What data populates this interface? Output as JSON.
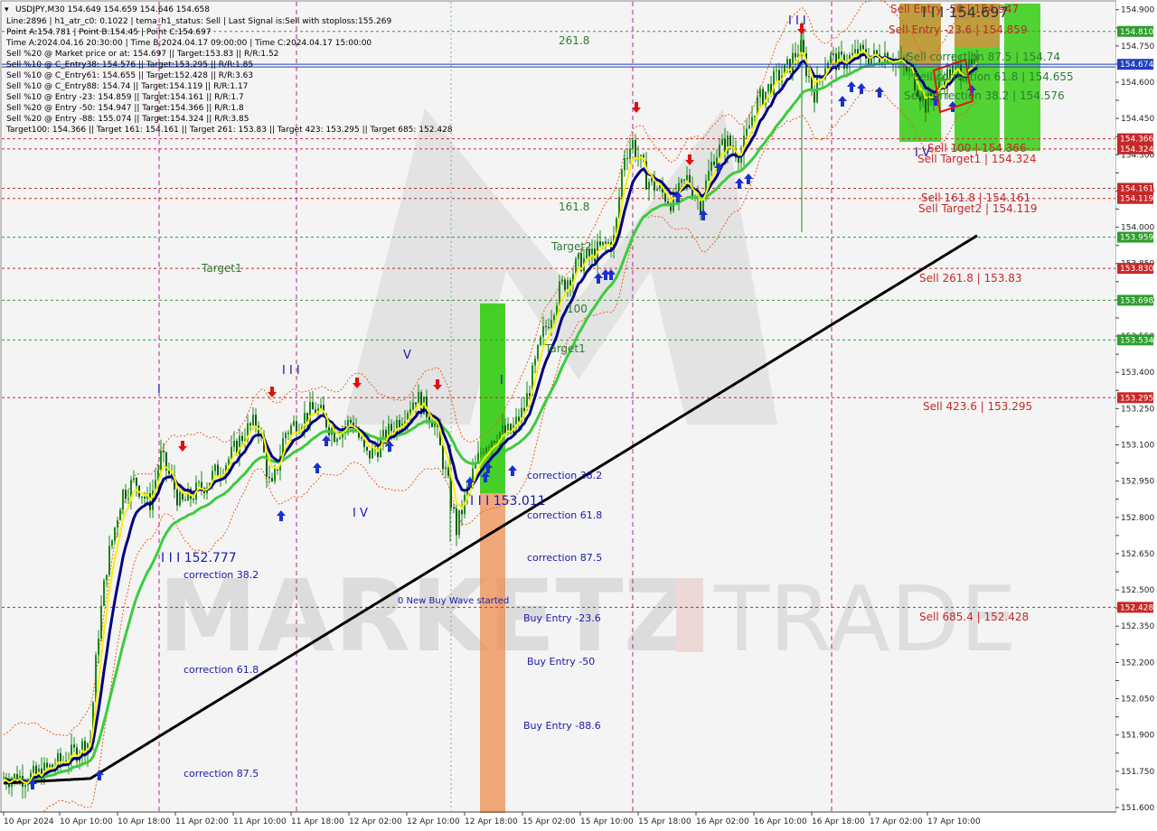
{
  "window": {
    "title": "USDJPY,M30"
  },
  "info_lines": [
    "USDJPY,M30   154.649 154.659 154.646 154.658",
    "Line:2896 | h1_atr_c0: 0.1022 | tema_h1_status: Sell | Last Signal is:Sell with stoploss:155.269",
    "Point A:154.781 | Point B:154.45 | Point C:154.697",
    "Time A:2024.04.16 20:30:00 | Time B:2024.04.17 09:00:00 | Time C:2024.04.17 15:00:00",
    "Sell %20 @ Market price or at: 154.697 || Target:153.83 || R/R:1.52",
    "Sell %10 @ C_Entry38: 154.576 || Target:153.295 || R/R:1.85",
    "Sell %10 @ C_Entry61: 154.655 || Target:152.428 || R/R:3.63",
    "Sell %10 @ C_Entry88: 154.74 || Target:154.119 || R/R:1.17",
    "Sell %10 @ Entry -23: 154.859 || Target:154.161 || R/R:1.7",
    "Sell %20 @ Entry -50: 154.947 || Target:154.366 || R/R:1.8",
    "Sell %20 @ Entry -88: 155.074 || Target:154.324 || R/R:3.85",
    "Target100: 154.366 || Target 161: 154.161 || Target 261: 153.83 || Target 423: 153.295 || Target 685: 152.428"
  ],
  "watermark": {
    "left": "MARKETZ",
    "right": "TRADE"
  },
  "colors": {
    "candle": "#1a8a1a",
    "ema_fast": "#ffee00",
    "ema_mid": "#000080",
    "ema_slow": "#3ccc3c",
    "ema_long": "#000000",
    "level_red": "#c62828",
    "level_green": "#2e7d32",
    "zone_green": "#33cc11",
    "zone_orange": "#ee8844",
    "current_price_bg": "#1f3fbf"
  },
  "chart_data": {
    "type": "candlestick",
    "symbol": "USDJPY",
    "timeframe": "M30",
    "ylim": [
      151.6,
      154.925
    ],
    "y_ticks": [
      151.6,
      151.675,
      151.75,
      151.825,
      151.9,
      151.975,
      152.05,
      152.125,
      152.2,
      152.275,
      152.35,
      152.425,
      152.5,
      152.575,
      152.65,
      152.725,
      152.8,
      152.875,
      152.95,
      153.025,
      153.1,
      153.175,
      153.25,
      153.325,
      153.4,
      153.475,
      153.55,
      153.625,
      153.7,
      153.775,
      153.85,
      153.925,
      154.0,
      154.075,
      154.15,
      154.225,
      154.3,
      154.375,
      154.45,
      154.525,
      154.6,
      154.675,
      154.75,
      154.825,
      154.9
    ],
    "y_tick_labels": [
      "151.600",
      "",
      "151.750",
      "",
      "151.900",
      "",
      "152.050",
      "",
      "152.200",
      "",
      "152.350",
      "",
      "152.500",
      "",
      "152.650",
      "",
      "152.800",
      "",
      "152.950",
      "",
      "153.100",
      "",
      "153.250",
      "",
      "153.400",
      "",
      "153.550",
      "",
      "153.700",
      "",
      "153.850",
      "",
      "154.000",
      "",
      "154.150",
      "",
      "154.300",
      "",
      "154.450",
      "",
      "154.600",
      "",
      "154.750",
      "",
      "154.900"
    ],
    "x_tick_labels": [
      "10 Apr 2024",
      "10 Apr 10:00",
      "10 Apr 18:00",
      "11 Apr 02:00",
      "11 Apr 10:00",
      "11 Apr 18:00",
      "12 Apr 02:00",
      "12 Apr 10:00",
      "12 Apr 18:00",
      "15 Apr 02:00",
      "15 Apr 10:00",
      "15 Apr 18:00",
      "16 Apr 02:00",
      "16 Apr 10:00",
      "16 Apr 18:00",
      "17 Apr 02:00",
      "17 Apr 10:00"
    ],
    "current_price": 154.674,
    "right_axis_tags": [
      {
        "value": 154.81,
        "label": "154.810",
        "color": "#2e9e2e"
      },
      {
        "value": 154.674,
        "label": "154.674",
        "color": "#1f3fbf"
      },
      {
        "value": 154.366,
        "label": "154.366",
        "color": "#c62828"
      },
      {
        "value": 154.324,
        "label": "154.324",
        "color": "#c62828"
      },
      {
        "value": 154.161,
        "label": "154.161",
        "color": "#c62828"
      },
      {
        "value": 154.119,
        "label": "154.119",
        "color": "#c62828"
      },
      {
        "value": 153.959,
        "label": "153.959",
        "color": "#2e9e2e"
      },
      {
        "value": 153.83,
        "label": "153.830",
        "color": "#c62828"
      },
      {
        "value": 153.698,
        "label": "153.698",
        "color": "#2e9e2e"
      },
      {
        "value": 153.534,
        "label": "153.534",
        "color": "#2e9e2e"
      },
      {
        "value": 153.295,
        "label": "153.295",
        "color": "#c62828"
      },
      {
        "value": 152.428,
        "label": "152.428",
        "color": "#c62828"
      }
    ],
    "level_labels": [
      {
        "text": "Sell Entry -50 | 154.947",
        "value": 154.947,
        "color": "red"
      },
      {
        "text": "I I I 154.697",
        "value": 154.9,
        "color": "dark"
      },
      {
        "text": "Sell Entry -23.6 | 154.859",
        "value": 154.859,
        "color": "red"
      },
      {
        "text": "Sell correction 87.5 | 154.74",
        "value": 154.74,
        "color": "green"
      },
      {
        "text": "Sell correction 61.8 | 154.655",
        "value": 154.655,
        "color": "green"
      },
      {
        "text": "Sell correction 38.2 | 154.576",
        "value": 154.576,
        "color": "green"
      },
      {
        "text": "Sell 100 | 154.366",
        "value": 154.366,
        "color": "red"
      },
      {
        "text": "Sell Target1 | 154.324",
        "value": 154.324,
        "color": "red"
      },
      {
        "text": "Sell 161.8 | 154.161",
        "value": 154.161,
        "color": "red"
      },
      {
        "text": "Sell Target2 | 154.119",
        "value": 154.119,
        "color": "red"
      },
      {
        "text": "Sell  261.8 | 153.83",
        "value": 153.83,
        "color": "red"
      },
      {
        "text": "Sell  423.6 | 153.295",
        "value": 153.295,
        "color": "red"
      },
      {
        "text": "Sell  685.4 | 152.428",
        "value": 152.428,
        "color": "red"
      }
    ],
    "left_labels": [
      {
        "text": "261.8",
        "color": "green"
      },
      {
        "text": "161.8",
        "color": "green"
      },
      {
        "text": "Target2",
        "color": "green"
      },
      {
        "text": "100",
        "color": "green"
      },
      {
        "text": "Target1",
        "color": "green"
      },
      {
        "text": "Target1",
        "color": "green"
      },
      {
        "text": "correction 38.2",
        "color": "blue"
      },
      {
        "text": "correction 61.8",
        "color": "blue"
      },
      {
        "text": "correction 87.5",
        "color": "blue"
      },
      {
        "text": "I I I 153.011",
        "color": "blue"
      },
      {
        "text": "0 New Buy Wave started",
        "color": "blue"
      },
      {
        "text": "Buy Entry -23.6",
        "color": "blue"
      },
      {
        "text": "Buy Entry -50",
        "color": "blue"
      },
      {
        "text": "Buy Entry -88.6",
        "color": "blue"
      },
      {
        "text": "I I I 152.777",
        "color": "blue"
      },
      {
        "text": "correction 38.2",
        "color": "blue"
      },
      {
        "text": "correction 61.8",
        "color": "blue"
      },
      {
        "text": "correction 87.5",
        "color": "blue"
      },
      {
        "text": "I I I",
        "color": "blue"
      },
      {
        "text": "I V",
        "color": "blue"
      },
      {
        "text": "V",
        "color": "blue"
      },
      {
        "text": "I",
        "color": "blue"
      },
      {
        "text": "I",
        "color": "blue"
      },
      {
        "text": "I I I",
        "color": "blue"
      },
      {
        "text": "I V",
        "color": "blue"
      }
    ],
    "green_levels": [
      154.81,
      153.959,
      153.698,
      153.534
    ],
    "red_levels": [
      154.366,
      154.324,
      154.161,
      154.119,
      153.83,
      153.295,
      152.428
    ],
    "series": [
      {
        "name": "price",
        "kind": "candles",
        "anchors": [
          [
            0,
            151.72
          ],
          [
            40,
            151.73
          ],
          [
            80,
            151.82
          ],
          [
            100,
            151.88
          ],
          [
            108,
            152.3
          ],
          [
            118,
            152.6
          ],
          [
            135,
            152.9
          ],
          [
            150,
            152.95
          ],
          [
            165,
            152.85
          ],
          [
            178,
            153.05
          ],
          [
            190,
            152.95
          ],
          [
            200,
            152.85
          ],
          [
            215,
            152.9
          ],
          [
            230,
            152.95
          ],
          [
            255,
            153.05
          ],
          [
            270,
            153.15
          ],
          [
            285,
            153.2
          ],
          [
            300,
            152.9
          ],
          [
            315,
            153.15
          ],
          [
            330,
            153.2
          ],
          [
            350,
            153.25
          ],
          [
            370,
            153.15
          ],
          [
            390,
            153.2
          ],
          [
            405,
            153.05
          ],
          [
            420,
            153.1
          ],
          [
            440,
            153.2
          ],
          [
            460,
            153.3
          ],
          [
            480,
            153.2
          ],
          [
            495,
            152.95
          ],
          [
            505,
            152.75
          ],
          [
            520,
            152.95
          ],
          [
            535,
            153.1
          ],
          [
            550,
            153.15
          ],
          [
            565,
            153.15
          ],
          [
            580,
            153.25
          ],
          [
            600,
            153.55
          ],
          [
            620,
            153.75
          ],
          [
            640,
            153.85
          ],
          [
            660,
            153.9
          ],
          [
            680,
            153.95
          ],
          [
            690,
            154.3
          ],
          [
            700,
            154.35
          ],
          [
            715,
            154.2
          ],
          [
            730,
            154.15
          ],
          [
            745,
            154.1
          ],
          [
            760,
            154.2
          ],
          [
            775,
            154.1
          ],
          [
            790,
            154.3
          ],
          [
            805,
            154.35
          ],
          [
            820,
            154.3
          ],
          [
            835,
            154.5
          ],
          [
            855,
            154.6
          ],
          [
            870,
            154.65
          ],
          [
            885,
            154.75
          ],
          [
            900,
            154.55
          ],
          [
            915,
            154.7
          ],
          [
            930,
            154.68
          ],
          [
            950,
            154.72
          ],
          [
            965,
            154.7
          ],
          [
            980,
            154.72
          ],
          [
            995,
            154.68
          ],
          [
            1010,
            154.62
          ],
          [
            1025,
            154.5
          ],
          [
            1040,
            154.6
          ],
          [
            1055,
            154.65
          ],
          [
            1070,
            154.65
          ],
          [
            1083,
            154.66
          ]
        ]
      },
      {
        "name": "ema_fast",
        "kind": "line",
        "color": "#ffee00"
      },
      {
        "name": "ema_mid",
        "kind": "line",
        "color": "#000080"
      },
      {
        "name": "ema_slow",
        "kind": "line",
        "color": "#3ccc3c"
      },
      {
        "name": "ema_long",
        "kind": "line",
        "color": "#000000"
      }
    ]
  }
}
